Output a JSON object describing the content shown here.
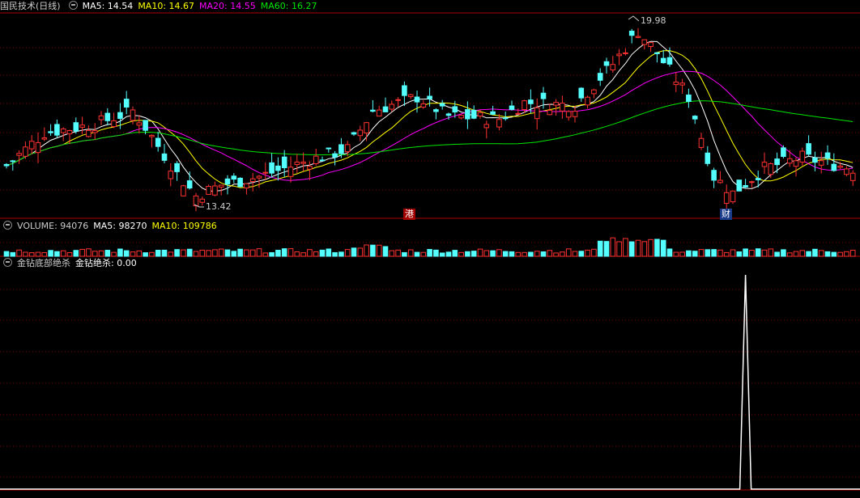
{
  "panel_main": {
    "title": "国民技术(日线)",
    "ma5": "MA5: 14.54",
    "ma10": "MA10: 14.67",
    "ma20": "MA20: 14.55",
    "ma60": "MA60: 16.27",
    "high_label": "19.98",
    "low_label": "13.42",
    "marker_hk": "港",
    "marker_fin": "财"
  },
  "panel_volume": {
    "title": "VOLUME: 94076",
    "ma5": "MA5: 98270",
    "ma10": "MA10: 109786"
  },
  "panel_indicator": {
    "title": "金钻底部绝杀",
    "value": "金钻绝杀: 0.00"
  },
  "colors": {
    "up": "#ff3232",
    "down": "#54ffff",
    "ma5": "#ffffff",
    "ma10": "#ffff00",
    "ma20": "#ff00ff",
    "ma60": "#00e600",
    "grid": "#7a0000",
    "signal": "#ffffff"
  },
  "chart_data": {
    "type": "candlestick",
    "price_high": 19.98,
    "price_low": 13.42,
    "indicator_peak_index": 117
  }
}
